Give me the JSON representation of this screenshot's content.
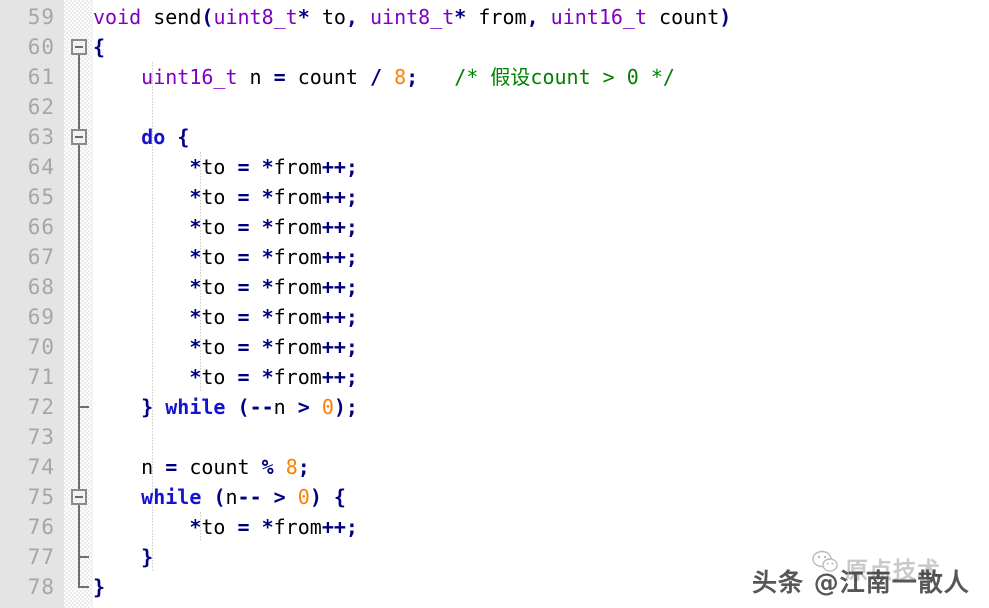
{
  "editor": {
    "language": "C",
    "first_line_number": 59,
    "line_height_px": 30,
    "colors": {
      "background": "#ffffff",
      "gutter_background": "#e4e4e4",
      "line_number": "#a6a6a6",
      "keyword_type": "#7f00c0",
      "keyword_control": "#1414cf",
      "punctuation": "#00007f",
      "number": "#ff8000",
      "comment": "#008000",
      "identifier": "#000000",
      "fold_marker": "#6e6e6e"
    },
    "line_numbers": [
      "59",
      "60",
      "61",
      "62",
      "63",
      "64",
      "65",
      "66",
      "67",
      "68",
      "69",
      "70",
      "71",
      "72",
      "73",
      "74",
      "75",
      "76",
      "77",
      "78"
    ],
    "fold_markers": [
      {
        "line": "60",
        "type": "box-collapse"
      },
      {
        "line": "63",
        "type": "box-collapse"
      },
      {
        "line": "72",
        "type": "tick-end"
      },
      {
        "line": "75",
        "type": "box-collapse"
      },
      {
        "line": "77",
        "type": "tick-end"
      },
      {
        "line": "78",
        "type": "corner-end"
      }
    ],
    "lines": [
      {
        "number": "59",
        "text": "void send(uint8_t* to, uint8_t* from, uint16_t count)",
        "tokens": [
          {
            "t": "void",
            "c": "kw"
          },
          {
            "t": " ",
            "c": "id"
          },
          {
            "t": "send",
            "c": "id"
          },
          {
            "t": "(",
            "c": "punc"
          },
          {
            "t": "uint8_t",
            "c": "kw"
          },
          {
            "t": "*",
            "c": "punc"
          },
          {
            "t": " to",
            "c": "id"
          },
          {
            "t": ",",
            "c": "punc"
          },
          {
            "t": " ",
            "c": "id"
          },
          {
            "t": "uint8_t",
            "c": "kw"
          },
          {
            "t": "*",
            "c": "punc"
          },
          {
            "t": " from",
            "c": "id"
          },
          {
            "t": ",",
            "c": "punc"
          },
          {
            "t": " ",
            "c": "id"
          },
          {
            "t": "uint16_t",
            "c": "kw"
          },
          {
            "t": " count",
            "c": "id"
          },
          {
            "t": ")",
            "c": "punc"
          }
        ]
      },
      {
        "number": "60",
        "text": "{",
        "tokens": [
          {
            "t": "{",
            "c": "punc"
          }
        ]
      },
      {
        "number": "61",
        "text": "    uint16_t n = count / 8;   /* 假设count > 0 */",
        "tokens": [
          {
            "t": "    ",
            "c": "id"
          },
          {
            "t": "uint16_t",
            "c": "kw"
          },
          {
            "t": " n ",
            "c": "id"
          },
          {
            "t": "=",
            "c": "punc"
          },
          {
            "t": " count ",
            "c": "id"
          },
          {
            "t": "/",
            "c": "punc"
          },
          {
            "t": " ",
            "c": "id"
          },
          {
            "t": "8",
            "c": "num"
          },
          {
            "t": ";",
            "c": "punc"
          },
          {
            "t": "   ",
            "c": "id"
          },
          {
            "t": "/* 假设count > 0 */",
            "c": "cmt"
          }
        ]
      },
      {
        "number": "62",
        "text": "",
        "tokens": []
      },
      {
        "number": "63",
        "text": "    do {",
        "tokens": [
          {
            "t": "    ",
            "c": "id"
          },
          {
            "t": "do",
            "c": "ctrl"
          },
          {
            "t": " ",
            "c": "id"
          },
          {
            "t": "{",
            "c": "punc"
          }
        ]
      },
      {
        "number": "64",
        "text": "        *to = *from++;",
        "tokens": [
          {
            "t": "        ",
            "c": "id"
          },
          {
            "t": "*",
            "c": "punc"
          },
          {
            "t": "to ",
            "c": "id"
          },
          {
            "t": "=",
            "c": "punc"
          },
          {
            "t": " ",
            "c": "id"
          },
          {
            "t": "*",
            "c": "punc"
          },
          {
            "t": "from",
            "c": "id"
          },
          {
            "t": "++;",
            "c": "punc"
          }
        ]
      },
      {
        "number": "65",
        "text": "        *to = *from++;",
        "tokens": [
          {
            "t": "        ",
            "c": "id"
          },
          {
            "t": "*",
            "c": "punc"
          },
          {
            "t": "to ",
            "c": "id"
          },
          {
            "t": "=",
            "c": "punc"
          },
          {
            "t": " ",
            "c": "id"
          },
          {
            "t": "*",
            "c": "punc"
          },
          {
            "t": "from",
            "c": "id"
          },
          {
            "t": "++;",
            "c": "punc"
          }
        ]
      },
      {
        "number": "66",
        "text": "        *to = *from++;",
        "tokens": [
          {
            "t": "        ",
            "c": "id"
          },
          {
            "t": "*",
            "c": "punc"
          },
          {
            "t": "to ",
            "c": "id"
          },
          {
            "t": "=",
            "c": "punc"
          },
          {
            "t": " ",
            "c": "id"
          },
          {
            "t": "*",
            "c": "punc"
          },
          {
            "t": "from",
            "c": "id"
          },
          {
            "t": "++;",
            "c": "punc"
          }
        ]
      },
      {
        "number": "67",
        "text": "        *to = *from++;",
        "tokens": [
          {
            "t": "        ",
            "c": "id"
          },
          {
            "t": "*",
            "c": "punc"
          },
          {
            "t": "to ",
            "c": "id"
          },
          {
            "t": "=",
            "c": "punc"
          },
          {
            "t": " ",
            "c": "id"
          },
          {
            "t": "*",
            "c": "punc"
          },
          {
            "t": "from",
            "c": "id"
          },
          {
            "t": "++;",
            "c": "punc"
          }
        ]
      },
      {
        "number": "68",
        "text": "        *to = *from++;",
        "tokens": [
          {
            "t": "        ",
            "c": "id"
          },
          {
            "t": "*",
            "c": "punc"
          },
          {
            "t": "to ",
            "c": "id"
          },
          {
            "t": "=",
            "c": "punc"
          },
          {
            "t": " ",
            "c": "id"
          },
          {
            "t": "*",
            "c": "punc"
          },
          {
            "t": "from",
            "c": "id"
          },
          {
            "t": "++;",
            "c": "punc"
          }
        ]
      },
      {
        "number": "69",
        "text": "        *to = *from++;",
        "tokens": [
          {
            "t": "        ",
            "c": "id"
          },
          {
            "t": "*",
            "c": "punc"
          },
          {
            "t": "to ",
            "c": "id"
          },
          {
            "t": "=",
            "c": "punc"
          },
          {
            "t": " ",
            "c": "id"
          },
          {
            "t": "*",
            "c": "punc"
          },
          {
            "t": "from",
            "c": "id"
          },
          {
            "t": "++;",
            "c": "punc"
          }
        ]
      },
      {
        "number": "70",
        "text": "        *to = *from++;",
        "tokens": [
          {
            "t": "        ",
            "c": "id"
          },
          {
            "t": "*",
            "c": "punc"
          },
          {
            "t": "to ",
            "c": "id"
          },
          {
            "t": "=",
            "c": "punc"
          },
          {
            "t": " ",
            "c": "id"
          },
          {
            "t": "*",
            "c": "punc"
          },
          {
            "t": "from",
            "c": "id"
          },
          {
            "t": "++;",
            "c": "punc"
          }
        ]
      },
      {
        "number": "71",
        "text": "        *to = *from++;",
        "tokens": [
          {
            "t": "        ",
            "c": "id"
          },
          {
            "t": "*",
            "c": "punc"
          },
          {
            "t": "to ",
            "c": "id"
          },
          {
            "t": "=",
            "c": "punc"
          },
          {
            "t": " ",
            "c": "id"
          },
          {
            "t": "*",
            "c": "punc"
          },
          {
            "t": "from",
            "c": "id"
          },
          {
            "t": "++;",
            "c": "punc"
          }
        ]
      },
      {
        "number": "72",
        "text": "    } while (--n > 0);",
        "tokens": [
          {
            "t": "    ",
            "c": "id"
          },
          {
            "t": "}",
            "c": "punc"
          },
          {
            "t": " ",
            "c": "id"
          },
          {
            "t": "while",
            "c": "ctrl"
          },
          {
            "t": " ",
            "c": "id"
          },
          {
            "t": "(--",
            "c": "punc"
          },
          {
            "t": "n ",
            "c": "id"
          },
          {
            "t": ">",
            "c": "punc"
          },
          {
            "t": " ",
            "c": "id"
          },
          {
            "t": "0",
            "c": "num"
          },
          {
            "t": ");",
            "c": "punc"
          }
        ]
      },
      {
        "number": "73",
        "text": "",
        "tokens": []
      },
      {
        "number": "74",
        "text": "    n = count % 8;",
        "tokens": [
          {
            "t": "    ",
            "c": "id"
          },
          {
            "t": "n ",
            "c": "id"
          },
          {
            "t": "=",
            "c": "punc"
          },
          {
            "t": " count ",
            "c": "id"
          },
          {
            "t": "%",
            "c": "punc"
          },
          {
            "t": " ",
            "c": "id"
          },
          {
            "t": "8",
            "c": "num"
          },
          {
            "t": ";",
            "c": "punc"
          }
        ]
      },
      {
        "number": "75",
        "text": "    while (n-- > 0) {",
        "tokens": [
          {
            "t": "    ",
            "c": "id"
          },
          {
            "t": "while",
            "c": "ctrl"
          },
          {
            "t": " ",
            "c": "id"
          },
          {
            "t": "(",
            "c": "punc"
          },
          {
            "t": "n",
            "c": "id"
          },
          {
            "t": "--",
            "c": "punc"
          },
          {
            "t": " ",
            "c": "id"
          },
          {
            "t": ">",
            "c": "punc"
          },
          {
            "t": " ",
            "c": "id"
          },
          {
            "t": "0",
            "c": "num"
          },
          {
            "t": ")",
            "c": "punc"
          },
          {
            "t": " ",
            "c": "id"
          },
          {
            "t": "{",
            "c": "punc"
          }
        ]
      },
      {
        "number": "76",
        "text": "        *to = *from++;",
        "tokens": [
          {
            "t": "        ",
            "c": "id"
          },
          {
            "t": "*",
            "c": "punc"
          },
          {
            "t": "to ",
            "c": "id"
          },
          {
            "t": "=",
            "c": "punc"
          },
          {
            "t": " ",
            "c": "id"
          },
          {
            "t": "*",
            "c": "punc"
          },
          {
            "t": "from",
            "c": "id"
          },
          {
            "t": "++;",
            "c": "punc"
          }
        ]
      },
      {
        "number": "77",
        "text": "    }",
        "tokens": [
          {
            "t": "    ",
            "c": "id"
          },
          {
            "t": "}",
            "c": "punc"
          }
        ]
      },
      {
        "number": "78",
        "text": "}",
        "tokens": [
          {
            "t": "}",
            "c": "punc"
          }
        ]
      }
    ]
  },
  "watermarks": {
    "toutiao": "头条 @江南一散人",
    "wechat": "原点技术",
    "wechat_icon": "wechat-icon"
  }
}
